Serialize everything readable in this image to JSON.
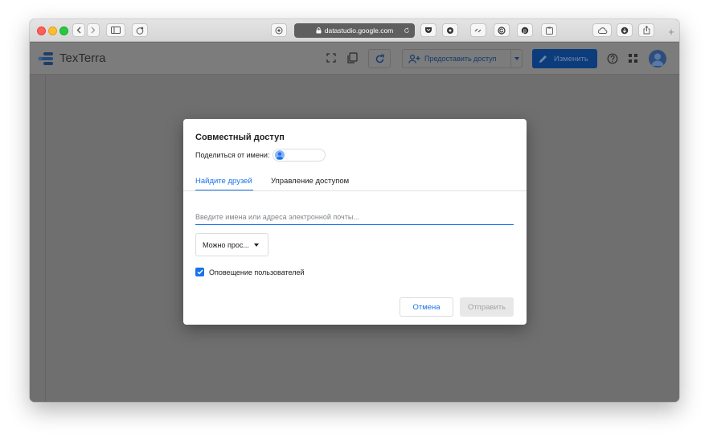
{
  "browser": {
    "url": "datastudio.google.com",
    "icons": [
      "sidebar-icon",
      "privacy-report-icon",
      "reader-icon",
      "pocket-icon",
      "extension-icon",
      "link-icon",
      "grammarly-icon",
      "pinterest-icon",
      "clipboard-icon",
      "cloud-icon",
      "download-icon",
      "share-icon",
      "new-tab-icon"
    ]
  },
  "app": {
    "title": "TexTerra",
    "share_label": "Предоставить доступ",
    "edit_label": "Изменить",
    "accent": "#0c3c7c"
  },
  "dialog": {
    "title": "Совместный доступ",
    "share_as_label": "Поделиться от имени:",
    "tabs": [
      {
        "label": "Найдите друзей",
        "active": true
      },
      {
        "label": "Управление доступом",
        "active": false
      }
    ],
    "email_placeholder": "Введите имена или адреса электронной почты...",
    "permission_value": "Можно прос...",
    "notify_label": "Оповещение пользователей",
    "notify_checked": true,
    "cancel_label": "Отмена",
    "send_label": "Отправить",
    "accent": "#1a73e8"
  }
}
